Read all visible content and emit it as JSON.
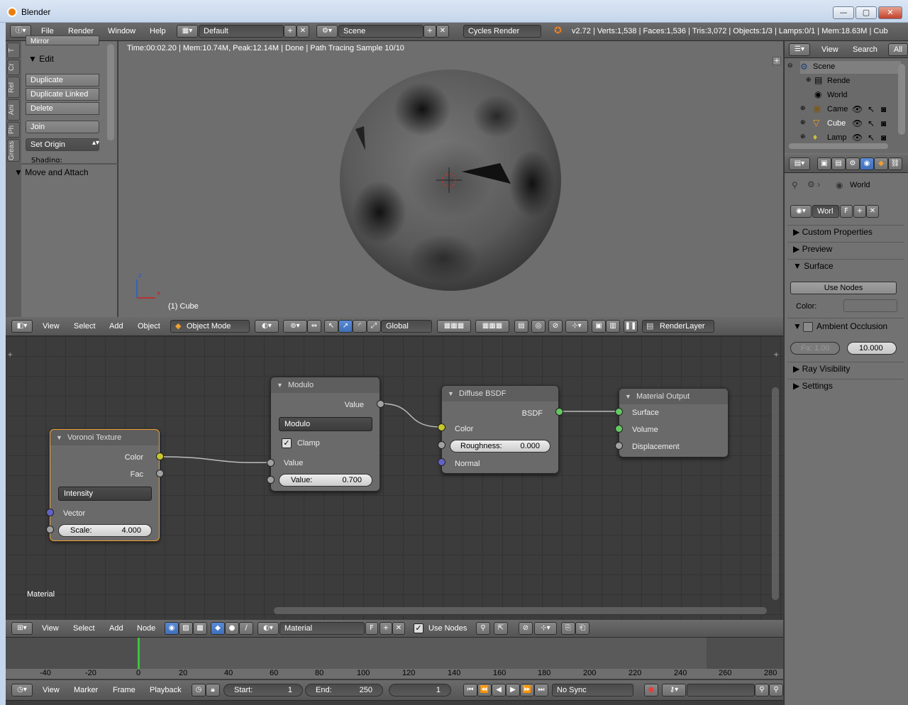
{
  "window": {
    "title": "Blender",
    "minimize": "—",
    "maximize": "▢",
    "close": "✕"
  },
  "info_header": {
    "menus": [
      "File",
      "Render",
      "Window",
      "Help"
    ],
    "layout": "Default",
    "scene": "Scene",
    "engine": "Cycles Render",
    "stats": "v2.72 | Verts:1,538 | Faces:1,536 | Tris:3,072 | Objects:1/3 | Lamps:0/1 | Mem:18.63M | Cub"
  },
  "toolshelf": {
    "tabs": [
      "T",
      "Cr",
      "Rel",
      "Ani",
      "Ph",
      "Greas"
    ],
    "cut_label": "Mirror",
    "edit_title": "Edit",
    "buttons": [
      "Duplicate",
      "Duplicate Linked",
      "Delete",
      "Join",
      "Set Origin"
    ],
    "shading_cut": "Shading:",
    "move_title": "Move and Attach"
  },
  "viewport": {
    "render_info": "Time:00:02.20 | Mem:10.74M, Peak:12.14M | Done | Path Tracing Sample 10/10",
    "object_label": "(1) Cube",
    "axis_z": "z",
    "axis_x": "x"
  },
  "view3d_header": {
    "menus": [
      "View",
      "Select",
      "Add",
      "Object"
    ],
    "mode": "Object Mode",
    "orientation": "Global",
    "render_layer": "RenderLayer"
  },
  "nodes": {
    "voronoi": {
      "title": "Voronoi Texture",
      "out_color": "Color",
      "out_fac": "Fac",
      "coloring": "Intensity",
      "in_vector": "Vector",
      "scale_label": "Scale:",
      "scale_value": "4.000"
    },
    "modulo": {
      "title": "Modulo",
      "out_value": "Value",
      "operation": "Modulo",
      "clamp": "Clamp",
      "in_value": "Value",
      "value_label": "Value:",
      "value_value": "0.700"
    },
    "diffuse": {
      "title": "Diffuse BSDF",
      "out_bsdf": "BSDF",
      "in_color": "Color",
      "rough_label": "Roughness:",
      "rough_value": "0.000",
      "in_normal": "Normal"
    },
    "output": {
      "title": "Material Output",
      "in_surface": "Surface",
      "in_volume": "Volume",
      "in_displacement": "Displacement"
    },
    "editor_label": "Material"
  },
  "node_header": {
    "menus": [
      "View",
      "Select",
      "Add",
      "Node"
    ],
    "material": "Material",
    "fake_user": "F",
    "use_nodes": "Use Nodes"
  },
  "timeline": {
    "ticks": [
      "-40",
      "-20",
      "0",
      "20",
      "40",
      "60",
      "80",
      "100",
      "120",
      "140",
      "160",
      "180",
      "200",
      "220",
      "240",
      "260",
      "280"
    ],
    "current_frame_pos": 0,
    "menus": [
      "View",
      "Marker",
      "Frame",
      "Playback"
    ],
    "start_label": "Start:",
    "start_value": "1",
    "end_label": "End:",
    "end_value": "250",
    "current": "1",
    "sync": "No Sync"
  },
  "outliner": {
    "menus": [
      "View",
      "Search"
    ],
    "filter": "All",
    "items": [
      "Scene",
      "Rende",
      "World",
      "Came",
      "Cube",
      "Lamp"
    ]
  },
  "properties": {
    "breadcrumb": "World",
    "datablock": "Worl",
    "fake_user": "F",
    "panels": [
      "Custom Properties",
      "Preview",
      "Surface"
    ],
    "use_nodes": "Use Nodes",
    "color_label": "Color:",
    "ao_label": "Ambient Occlusion",
    "ao_factor": "Fa: 1.00",
    "ao_distance": "10.000",
    "panels2": [
      "Ray Visibility",
      "Settings"
    ]
  }
}
